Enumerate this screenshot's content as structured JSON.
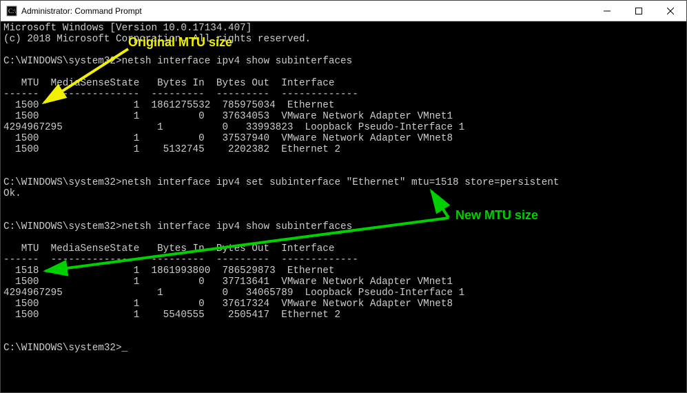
{
  "window": {
    "title": "Administrator: Command Prompt"
  },
  "terminal": {
    "header1": "Microsoft Windows [Version 10.0.17134.407]",
    "header2": "(c) 2018 Microsoft Corporation. All rights reserved.",
    "prompt_path": "C:\\WINDOWS\\system32>",
    "cmd1": "netsh interface ipv4 show subinterfaces",
    "cmd2": "netsh interface ipv4 set subinterface \"Ethernet\" mtu=1518 store=persistent",
    "cmd2_result": "Ok.",
    "cmd3": "netsh interface ipv4 show subinterfaces",
    "table_header": "   MTU  MediaSenseState   Bytes In  Bytes Out  Interface",
    "table_divider": "------  ---------------  ---------  ---------  -------------",
    "table1": {
      "rows": [
        "  1500                1  1861275532  785975034  Ethernet",
        "  1500                1          0   37634053  VMware Network Adapter VMnet1",
        "4294967295                1          0   33993823  Loopback Pseudo-Interface 1",
        "  1500                1          0   37537940  VMware Network Adapter VMnet8",
        "  1500                1    5132745    2202382  Ethernet 2"
      ]
    },
    "table2": {
      "rows": [
        "  1518                1  1861993800  786529873  Ethernet",
        "  1500                1          0   37713641  VMware Network Adapter VMnet1",
        "4294967295                1          0   34065789  Loopback Pseudo-Interface 1",
        "  1500                1          0   37617324  VMware Network Adapter VMnet8",
        "  1500                1    5540555    2505417  Ethernet 2"
      ]
    }
  },
  "annotations": {
    "original": "Original MTU size",
    "new": "New MTU size"
  }
}
